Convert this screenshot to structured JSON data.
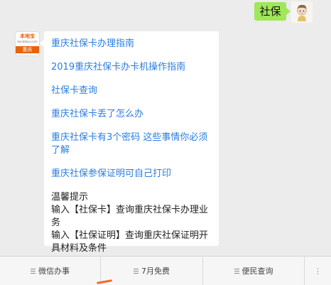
{
  "outgoing": {
    "text": "社保"
  },
  "bot": {
    "logo_top": "本地宝",
    "logo_sub": "bendibao.com",
    "logo_city": "重庆"
  },
  "reply": {
    "links": [
      "重庆社保卡办理指南",
      "2019重庆社保卡办卡机操作指南",
      "社保卡查询",
      "重庆社保卡丢了怎么办",
      "重庆社保卡有3个密码 这些事情你必须了解",
      "重庆社保参保证明可自己打印"
    ],
    "tip_title": "温馨提示",
    "tip_lines": [
      "输入【社保卡】查询重庆社保卡办理业务",
      "输入【社保证明】查询重庆社保证明开具材料及条件"
    ]
  },
  "menu": {
    "items": [
      "微信办事",
      "7月免费",
      "便民查询"
    ],
    "keyboard_glyph": "⋮"
  },
  "colors": {
    "outgoing_bubble": "#a0e759",
    "link": "#2a7de1",
    "brand_orange": "#e8620f"
  }
}
